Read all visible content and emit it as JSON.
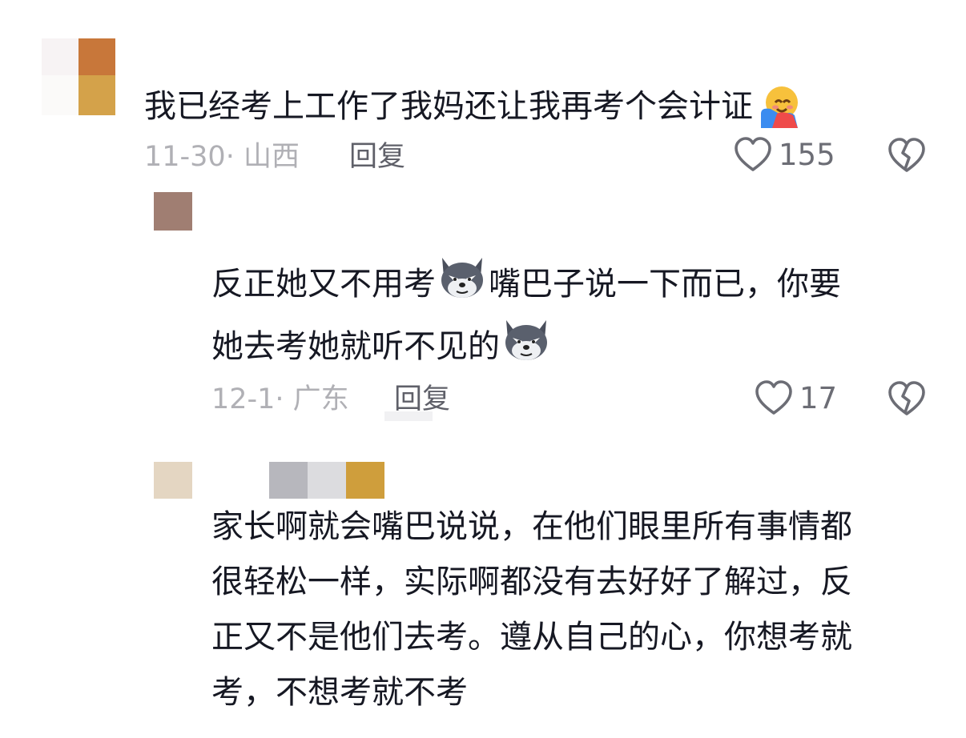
{
  "comments": [
    {
      "text": "我已经考上工作了我妈还让我再考个会计证",
      "emoji": "hugging-face-emoji",
      "date_location": "11-30· 山西",
      "reply_label": "回复",
      "like_count": "155"
    }
  ],
  "replies": [
    {
      "text_part1": "反正她又不用考",
      "text_part2": "嘴巴子说一下而已，你要",
      "text_part3": "她去考她就听不见的",
      "emoji": "wolf-face-emoji",
      "date_location": "12-1· 广东",
      "reply_label": "回复",
      "like_count": "17"
    },
    {
      "line1": "家长啊就会嘴巴说说，在他们眼里所有事情都",
      "line2": "很轻松一样，实际啊都没有去好好了解过，反",
      "line3": "正又不是他们去考。遵从自己的心，你想考就",
      "line4": "考，不想考就不考"
    }
  ],
  "colors": {
    "text": "#161823",
    "meta": "#b0b0b5",
    "reply": "#5f6069",
    "icon": "#6c6d75"
  }
}
